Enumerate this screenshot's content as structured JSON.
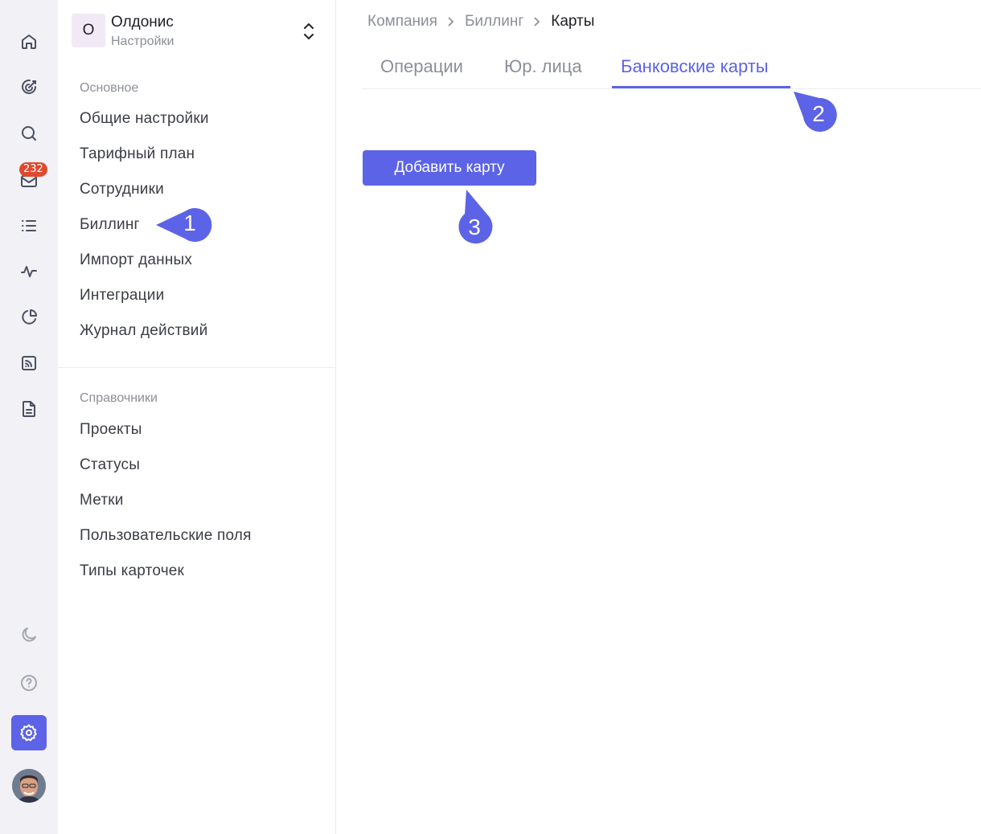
{
  "rail": {
    "inbox_badge": "232",
    "icons": [
      "home-icon",
      "target-icon",
      "search-icon",
      "inbox-icon",
      "list-icon",
      "activity-icon",
      "pie-chart-icon",
      "rss-icon",
      "document-icon",
      "moon-icon",
      "help-icon",
      "gear-icon",
      "avatar"
    ]
  },
  "org": {
    "initial": "О",
    "name": "Олдонис",
    "subtitle": "Настройки"
  },
  "sidebar": {
    "main_title": "Основное",
    "main_items": [
      "Общие настройки",
      "Тарифный план",
      "Сотрудники",
      "Биллинг",
      "Импорт данных",
      "Интеграции",
      "Журнал действий"
    ],
    "ref_title": "Справочники",
    "ref_items": [
      "Проекты",
      "Статусы",
      "Метки",
      "Пользовательские поля",
      "Типы карточек"
    ]
  },
  "breadcrumb": [
    "Компания",
    "Биллинг",
    "Карты"
  ],
  "tabs": [
    "Операции",
    "Юр. лица",
    "Банковские карты"
  ],
  "active_tab": "Банковские карты",
  "add_card_button": "Добавить карту",
  "callouts": [
    "1",
    "2",
    "3"
  ],
  "colors": {
    "accent": "#5c63e6",
    "badge": "#e0492f",
    "rail_bg": "#f1f1f6",
    "org_avatar_bg": "#f2e9f6"
  }
}
